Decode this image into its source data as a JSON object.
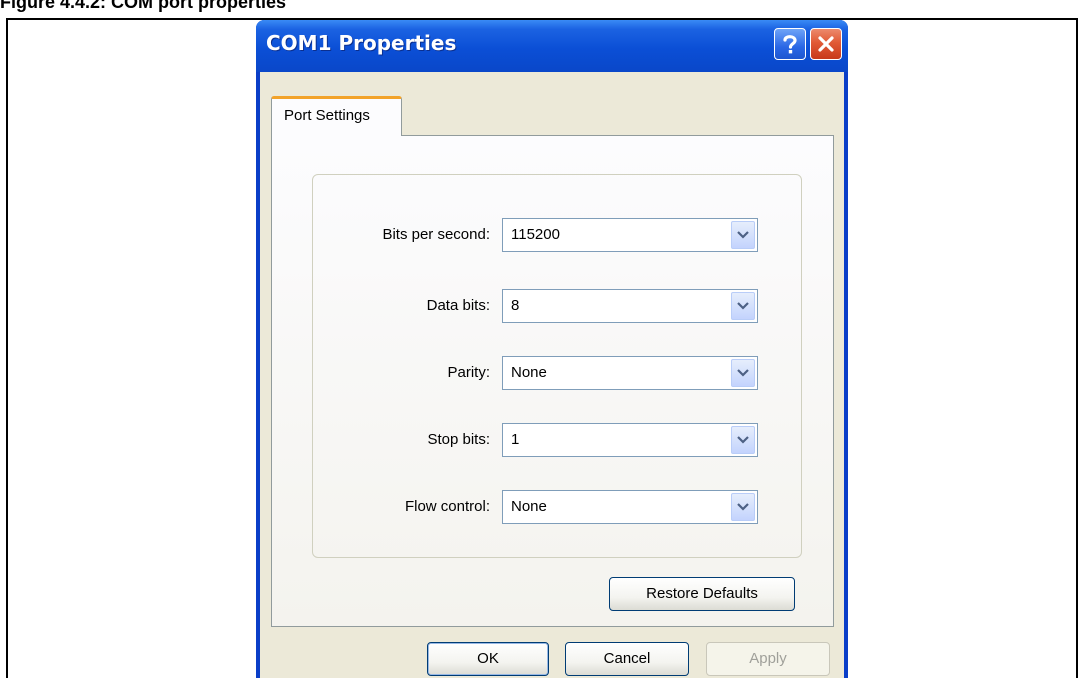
{
  "figure": {
    "caption": "Figure 4.4.2: COM port properties"
  },
  "window": {
    "title": "COM1 Properties",
    "help_icon": "help-icon",
    "close_icon": "close-icon",
    "colors": {
      "titlebar": "#0b4fd6",
      "client": "#ece9d8",
      "tab_accent": "#f2a32a"
    }
  },
  "tabs": [
    {
      "label": "Port Settings",
      "selected": true
    }
  ],
  "port_settings": {
    "fields": [
      {
        "label": "Bits per second:",
        "value": "115200"
      },
      {
        "label": "Data bits:",
        "value": "8"
      },
      {
        "label": "Parity:",
        "value": "None"
      },
      {
        "label": "Stop bits:",
        "value": "1"
      },
      {
        "label": "Flow control:",
        "value": "None"
      }
    ],
    "dropdown_icon": "chevron-down-icon",
    "restore_defaults_label": "Restore Defaults"
  },
  "buttons": {
    "ok_label": "OK",
    "cancel_label": "Cancel",
    "apply_label": "Apply",
    "apply_enabled": false
  }
}
